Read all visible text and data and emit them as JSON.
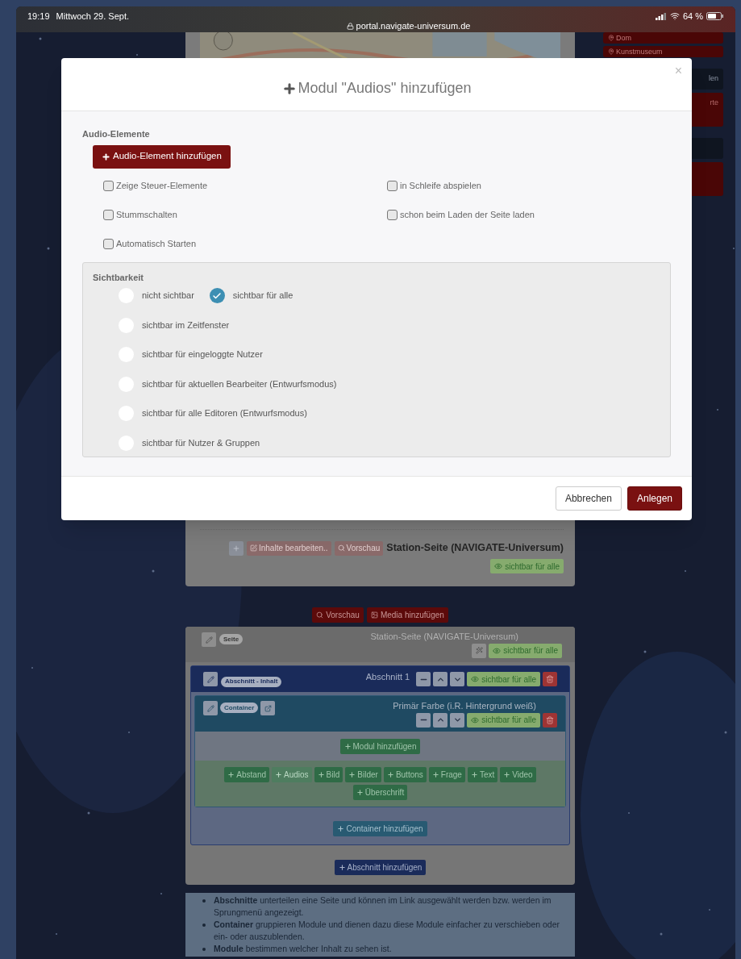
{
  "status_bar": {
    "time": "19:19",
    "date": "Mittwoch 29. Sept.",
    "url": "portal.navigate-universum.de",
    "battery": "64 %"
  },
  "sidebar": {
    "items": [
      {
        "label": "Dom",
        "kind": "place"
      },
      {
        "label": "Kunstmuseum",
        "kind": "place"
      },
      {
        "label": "len",
        "kind": "dark"
      },
      {
        "label": "rte",
        "kind": "red"
      },
      {
        "kind": "dark"
      },
      {
        "kind": "red"
      }
    ]
  },
  "preview_card": {
    "buttons": [
      {
        "kind": "add"
      },
      {
        "kind": "edit",
        "label": "Inhalte bearbeiten.."
      },
      {
        "kind": "preview",
        "label": "Vorschau"
      }
    ],
    "title": "Station-Seite (NAVIGATE-Universum)",
    "visibility": "sichtbar für alle"
  },
  "toolbar": [
    {
      "kind": "preview",
      "label": "Vorschau"
    },
    {
      "kind": "media",
      "label": "Media hinzufügen"
    }
  ],
  "page_panel": {
    "badge": "Seite",
    "title": "Station-Seite (NAVIGATE-Universum)",
    "visibility": "sichtbar für alle",
    "section": {
      "badge": "Abschnitt - Inhalt",
      "title": "Abschnitt 1",
      "visibility": "sichtbar für alle",
      "container": {
        "badge": "Container",
        "title": "Primär Farbe (i.R. Hintergrund weiß)",
        "visibility": "sichtbar für alle",
        "add_module": "Modul hinzufügen",
        "modules": [
          {
            "label": "Abstand",
            "selected": false
          },
          {
            "label": "Audios",
            "selected": true
          },
          {
            "label": "Bild",
            "selected": false
          },
          {
            "label": "Bilder",
            "selected": false
          },
          {
            "label": "Buttons",
            "selected": false
          },
          {
            "label": "Frage",
            "selected": false
          },
          {
            "label": "Text",
            "selected": false
          },
          {
            "label": "Video",
            "selected": false
          },
          {
            "label": "Überschrift",
            "selected": false
          }
        ]
      },
      "add_container": "Container hinzufügen"
    },
    "add_section": "Abschnitt hinzufügen"
  },
  "info": [
    "**Abschnitte** unterteilen eine Seite und können im Link ausgewählt werden bzw. werden im Sprungmenü angezeigt.",
    "**Container** gruppieren Module und dienen dazu diese Module einfacher zu verschieben oder ein- oder auszublenden.",
    "**Module** bestimmen welcher Inhalt zu sehen ist."
  ],
  "modal": {
    "title": "Modul \"Audios\" hinzufügen",
    "close": "×",
    "section_label": "Audio-Elemente",
    "add_button": "Audio-Element hinzufügen",
    "options": [
      {
        "label": "Zeige Steuer-Elemente",
        "checked": false
      },
      {
        "label": "in Schleife abspielen",
        "checked": false
      },
      {
        "label": "Stummschalten",
        "checked": false
      },
      {
        "label": "schon beim Laden der Seite laden",
        "checked": false
      },
      {
        "label": "Automatisch Starten",
        "checked": false
      }
    ],
    "visibility": {
      "label": "Sichtbarkeit",
      "options": [
        {
          "label": "nicht sichtbar",
          "selected": false
        },
        {
          "label": "sichtbar für alle",
          "selected": true
        },
        {
          "label": "sichtbar im Zeitfenster",
          "selected": false
        },
        {
          "label": "sichtbar für eingeloggte Nutzer",
          "selected": false
        },
        {
          "label": "sichtbar für aktuellen Bearbeiter (Entwurfsmodus)",
          "selected": false
        },
        {
          "label": "sichtbar für alle Editoren (Entwurfsmodus)",
          "selected": false
        },
        {
          "label": "sichtbar für Nutzer & Gruppen",
          "selected": false
        }
      ]
    },
    "buttons": [
      {
        "label": "Abbrechen",
        "kind": "secondary"
      },
      {
        "label": "Anlegen",
        "kind": "primary"
      }
    ]
  }
}
